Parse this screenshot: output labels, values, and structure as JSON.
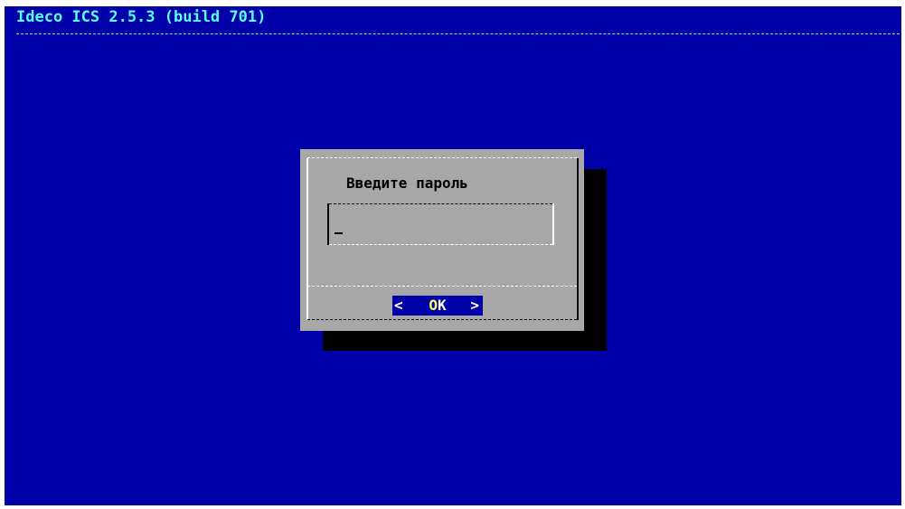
{
  "backtitle": "Ideco ICS 2.5.3 (build 701)",
  "dialog": {
    "prompt": "Введите пароль",
    "password_value": "",
    "ok_button": {
      "label_hotkey": "O",
      "label_rest": "K",
      "left_bracket": "<",
      "right_bracket": ">"
    }
  },
  "colors": {
    "screen_background": "#0000a8",
    "backtitle": "#55ffff",
    "dialog_background": "#a8a8a8",
    "shadow": "#000000",
    "button_active_background": "#0000a8",
    "button_hotkey": "#ffff55"
  }
}
